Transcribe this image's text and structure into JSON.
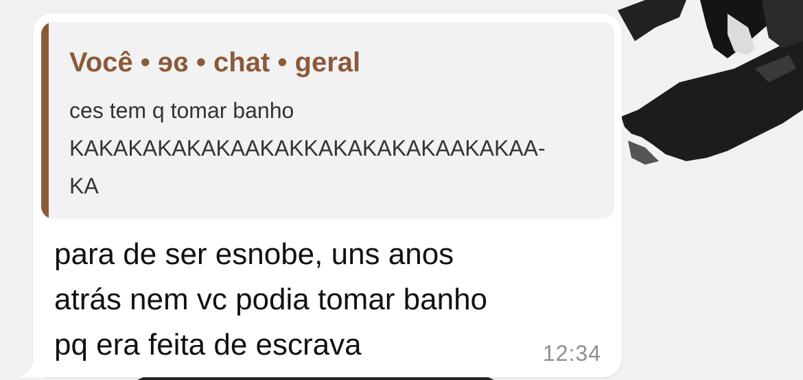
{
  "quoted_message": {
    "header": "Você • ɘɞ • chat • geral",
    "lines": [
      "ces tem q tomar banho",
      "KAKAKAKAKAKAAKAKKAKAKAKAKAAKAKAA-",
      "KA"
    ]
  },
  "message": {
    "lines": [
      "para de ser esnobe, uns anos",
      "atrás nem vc podia tomar banho",
      "pq era feita de escrava"
    ],
    "time": "12:34"
  },
  "colors": {
    "quote_accent": "#8b5a3a",
    "bubble_bg": "#ffffff",
    "quote_bg": "#f2f2f2",
    "wallpaper_bg": "#f1f1f1"
  }
}
